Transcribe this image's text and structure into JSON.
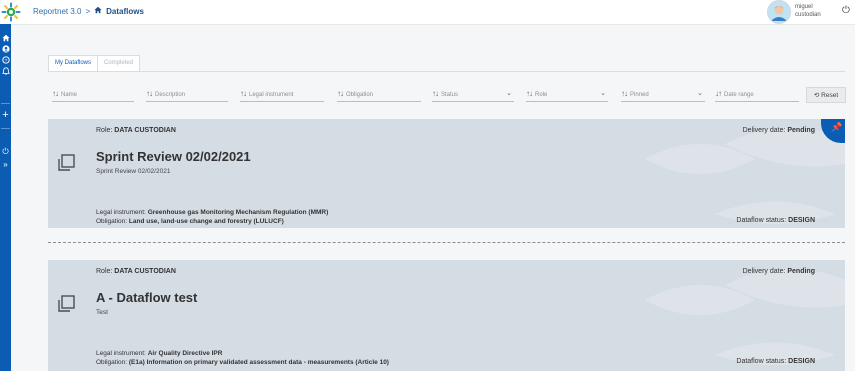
{
  "header": {
    "app": "Reportnet 3.0",
    "separator": ">",
    "page": "Dataflows",
    "user_line1": "miguel",
    "user_line2": "custodian"
  },
  "tabs": [
    {
      "label": "My Dataflows",
      "active": true
    },
    {
      "label": "Completed",
      "active": false
    }
  ],
  "filters": {
    "name": "Name",
    "description": "Description",
    "legal_instrument": "Legal instrument",
    "obligation": "Obligation",
    "status": "Status",
    "role": "Role",
    "pinned": "Pinned",
    "date_range": "Date range",
    "reset": "Reset"
  },
  "cards": [
    {
      "role_label": "Role:",
      "role": "DATA CUSTODIAN",
      "delivery_label": "Delivery date:",
      "delivery": "Pending",
      "title": "Sprint Review 02/02/2021",
      "description": "Sprint Review 02/02/2021",
      "legal_label": "Legal instrument:",
      "legal": "Greenhouse gas Monitoring Mechanism Regulation (MMR)",
      "obligation_label": "Obligation:",
      "obligation": "Land use, land-use change and forestry (LULUCF)",
      "status_label": "Dataflow status:",
      "status": "DESIGN",
      "pinned": true
    },
    {
      "role_label": "Role:",
      "role": "DATA CUSTODIAN",
      "delivery_label": "Delivery date:",
      "delivery": "Pending",
      "title": "A - Dataflow test",
      "description": "Test",
      "legal_label": "Legal instrument:",
      "legal": "Air Quality Directive IPR",
      "obligation_label": "Obligation:",
      "obligation": "(E1a) Information on primary validated assessment data - measurements (Article 10)",
      "status_label": "Dataflow status:",
      "status": "DESIGN",
      "pinned": false
    }
  ],
  "colors": {
    "sidebar": "#0b5db3",
    "card_bg": "#d5dde4",
    "pin_star": "#f3c316"
  }
}
